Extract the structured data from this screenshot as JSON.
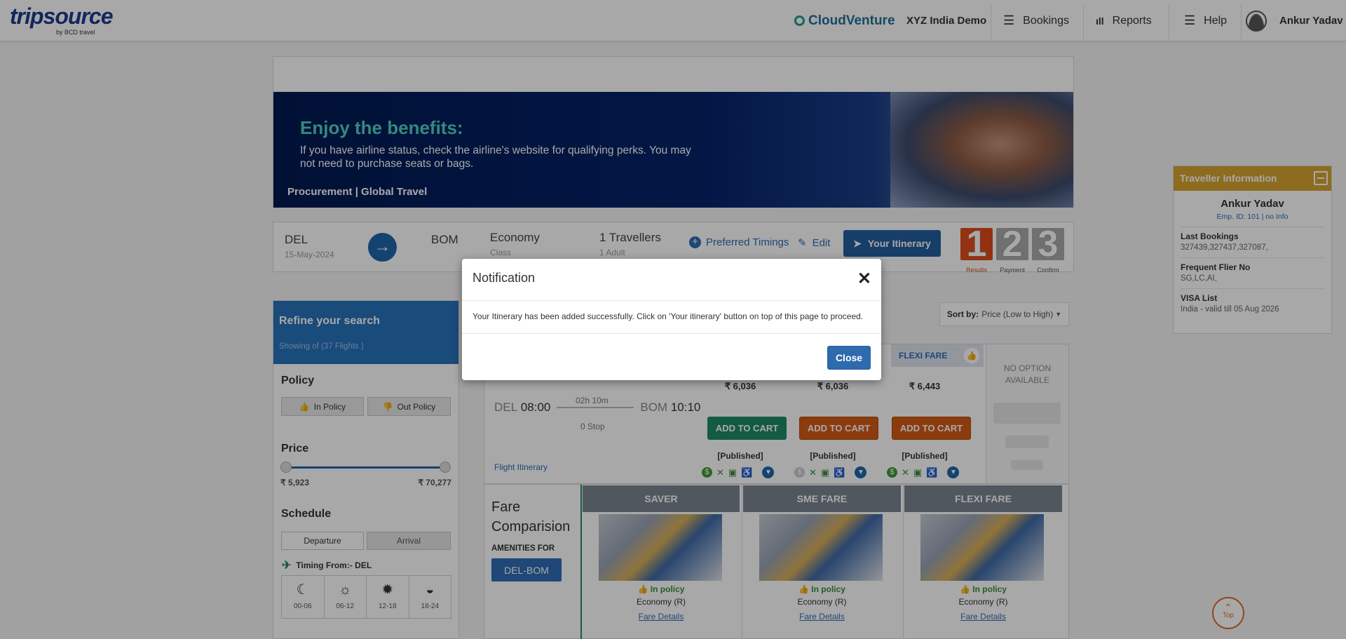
{
  "header": {
    "logo_main": "tripsource",
    "logo_sub": "by BCD travel",
    "partner_logo": "CloudVenture",
    "company": "XYZ India Demo",
    "nav": [
      "Bookings",
      "Reports",
      "Help"
    ],
    "user": "Ankur Yadav"
  },
  "banner": {
    "headline": "Enjoy the benefits:",
    "body": "If you have airline status, check the airline's website for qualifying perks. You may not need to purchase seats or bags.",
    "footer": "Procurement | Global Travel"
  },
  "search": {
    "origin": "DEL",
    "date": "15-May-2024",
    "destination": "BOM",
    "cabin": "Economy",
    "cabin_label": "Class",
    "travellers": "1 Travellers",
    "travellers_sub": "1 Adult",
    "preferred_timings": "Preferred Timings",
    "edit": "Edit",
    "your_itinerary": "Your Itinerary",
    "steps": [
      {
        "num": "1",
        "label": "Results"
      },
      {
        "num": "2",
        "label": "Payment"
      },
      {
        "num": "3",
        "label": "Confirm"
      }
    ]
  },
  "filters": {
    "refine_title": "Refine your search",
    "showing": "Showing of (37 Flights )",
    "policy_title": "Policy",
    "in_policy": "In Policy",
    "out_policy": "Out Policy",
    "price_title": "Price",
    "price_min": "₹ 5,923",
    "price_max": "₹ 70,277",
    "schedule_title": "Schedule",
    "departure": "Departure",
    "arrival": "Arrival",
    "timing_from": "Timing From:- DEL",
    "slots": [
      "00-06",
      "06-12",
      "12-18",
      "18-24"
    ]
  },
  "sort": {
    "label": "Sort by:",
    "value": "Price (Low to High)"
  },
  "flight": {
    "from_code": "DEL",
    "from_time": "08:00",
    "to_code": "BOM",
    "to_time": "10:10",
    "duration": "02h 10m",
    "stops": "0 Stop",
    "itinerary_link": "Flight Itinerary",
    "flexi_header": "FLEXI FARE",
    "no_option": "NO OPTION AVAILABLE",
    "fares": [
      {
        "price": "₹ 6,036",
        "button": "ADD TO CART",
        "type": "[Published]"
      },
      {
        "price": "₹ 6,036",
        "button": "ADD TO CART",
        "type": "[Published]"
      },
      {
        "price": "₹ 6,443",
        "button": "ADD TO CART",
        "type": "[Published]"
      }
    ]
  },
  "comparison": {
    "title": "Fare Comparision",
    "amenities_for": "AMENITIES FOR",
    "route_button": "DEL-BOM",
    "columns": [
      {
        "name": "SAVER",
        "policy": "In policy",
        "class": "Economy (R)",
        "link": "Fare Details"
      },
      {
        "name": "SME FARE",
        "policy": "In policy",
        "class": "Economy (R)",
        "link": "Fare Details"
      },
      {
        "name": "FLEXI FARE",
        "policy": "In policy",
        "class": "Economy (R)",
        "link": "Fare Details"
      }
    ]
  },
  "traveller": {
    "title": "Traveller Information",
    "name": "Ankur Yadav",
    "emp": "Emp. ID: 101 | no Info",
    "sections": [
      {
        "label": "Last Bookings",
        "value": "327439,327437,327087,"
      },
      {
        "label": "Frequent Flier No",
        "value": "SG,LC,AI,"
      },
      {
        "label": "VISA List",
        "value": "India - valid till 05 Aug 2026"
      }
    ]
  },
  "top_label": "Top",
  "modal": {
    "title": "Notification",
    "message": "Your Itinerary has been added successfully. Click on 'Your itinerary' button on top of this page to proceed.",
    "close": "Close"
  },
  "colors": {
    "primary": "#1e66ab",
    "add_to_cart_green": "#1e8a66",
    "add_to_cart_orange": "#d55a16",
    "traveller_header": "#d7a431",
    "step_active": "#e04b1b"
  }
}
